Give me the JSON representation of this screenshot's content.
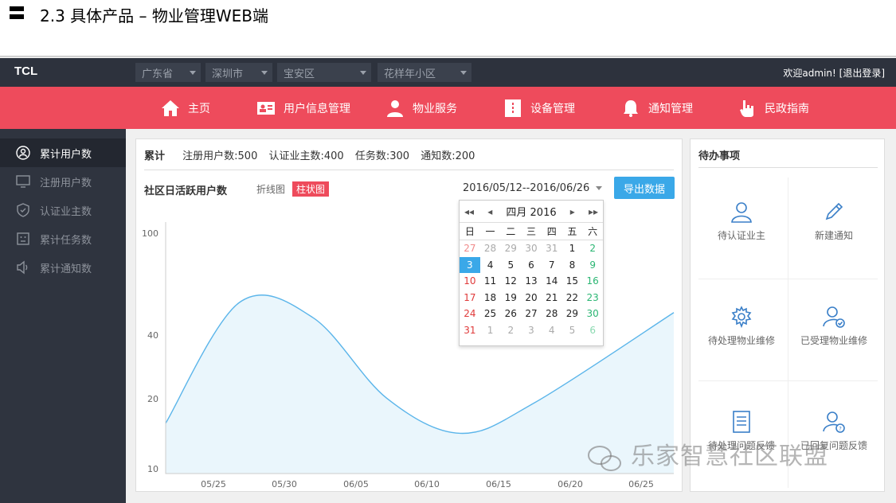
{
  "slide": {
    "title": "2.3 具体产品 – 物业管理WEB端"
  },
  "topbar": {
    "brand": "TCL",
    "selects": [
      "广东省",
      "深圳市",
      "宝安区",
      "花样年小区"
    ],
    "welcome": "欢迎admin! [退出登录]"
  },
  "nav": {
    "items": [
      {
        "label": "主页",
        "icon": "home-icon"
      },
      {
        "label": "用户信息管理",
        "icon": "id-card-icon"
      },
      {
        "label": "物业服务",
        "icon": "person-icon"
      },
      {
        "label": "设备管理",
        "icon": "device-icon"
      },
      {
        "label": "通知管理",
        "icon": "bell-icon"
      },
      {
        "label": "民政指南",
        "icon": "hand-icon"
      }
    ]
  },
  "sidebar": {
    "items": [
      {
        "label": "累计用户数",
        "icon": "user-circle-icon",
        "active": true
      },
      {
        "label": "注册用户数",
        "icon": "monitor-icon"
      },
      {
        "label": "认证业主数",
        "icon": "shield-icon"
      },
      {
        "label": "累计任务数",
        "icon": "task-icon"
      },
      {
        "label": "累计通知数",
        "icon": "speaker-icon"
      }
    ]
  },
  "stats": {
    "label": "累计",
    "items": [
      "注册用户数:500",
      "认证业主数:400",
      "任务数:300",
      "通知数:200"
    ]
  },
  "chart_header": {
    "title": "社区日活跃用户数",
    "tab_line": "折线图",
    "tab_bar": "柱状图",
    "date_range": "2016/05/12--2016/06/26",
    "export": "导出数据"
  },
  "calendar": {
    "month": "四月 2016",
    "weekdays": [
      "日",
      "一",
      "二",
      "三",
      "四",
      "五",
      "六"
    ],
    "days": [
      [
        "27",
        "28",
        "29",
        "30",
        "31",
        "1",
        "2"
      ],
      [
        "3",
        "4",
        "5",
        "6",
        "7",
        "8",
        "9"
      ],
      [
        "10",
        "11",
        "12",
        "13",
        "14",
        "15",
        "16"
      ],
      [
        "17",
        "18",
        "19",
        "20",
        "21",
        "22",
        "23"
      ],
      [
        "24",
        "25",
        "26",
        "27",
        "28",
        "29",
        "30"
      ],
      [
        "31",
        "1",
        "2",
        "3",
        "4",
        "5",
        "6"
      ]
    ],
    "selected": "3"
  },
  "todo": {
    "title": "待办事项",
    "items": [
      {
        "label": "待认证业主",
        "icon": "user-outline-icon"
      },
      {
        "label": "新建通知",
        "icon": "pencil-icon"
      },
      {
        "label": "待处理物业维修",
        "icon": "gear-icon"
      },
      {
        "label": "已受理物业维修",
        "icon": "user-check-icon"
      },
      {
        "label": "待处理问题反馈",
        "icon": "document-icon"
      },
      {
        "label": "已回复问题反馈",
        "icon": "user-question-icon"
      }
    ]
  },
  "watermark": "乐家智慧社区联盟",
  "chart_data": {
    "type": "area",
    "x": [
      "05/25",
      "05/30",
      "06/05",
      "06/10",
      "06/15",
      "06/20",
      "06/25"
    ],
    "y_ticks": [
      "100",
      "40",
      "20",
      "10"
    ],
    "points": [
      [
        0,
        20
      ],
      [
        1,
        68
      ],
      [
        2,
        62
      ],
      [
        3,
        30
      ],
      [
        4,
        16
      ],
      [
        5,
        28
      ],
      [
        6,
        64
      ]
    ],
    "color": "#5bb5ea",
    "fill": "#eaf6fc"
  }
}
